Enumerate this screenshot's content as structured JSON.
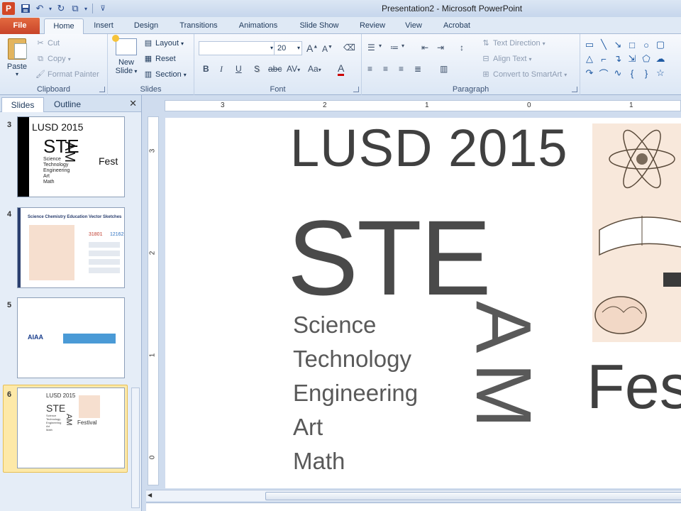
{
  "window": {
    "title": "Presentation2 - Microsoft PowerPoint",
    "app_icon_letter": "P"
  },
  "tabs": [
    {
      "label": "File"
    },
    {
      "label": "Home"
    },
    {
      "label": "Insert"
    },
    {
      "label": "Design"
    },
    {
      "label": "Transitions"
    },
    {
      "label": "Animations"
    },
    {
      "label": "Slide Show"
    },
    {
      "label": "Review"
    },
    {
      "label": "View"
    },
    {
      "label": "Acrobat"
    }
  ],
  "ribbon": {
    "clipboard": {
      "label": "Clipboard",
      "paste": "Paste",
      "cut": "Cut",
      "copy": "Copy",
      "format_painter": "Format Painter"
    },
    "slides": {
      "label": "Slides",
      "new_slide_1": "New",
      "new_slide_2": "Slide",
      "layout": "Layout",
      "reset": "Reset",
      "section": "Section"
    },
    "font": {
      "label": "Font",
      "font_name": "",
      "font_size": "20",
      "bold": "B",
      "italic": "I",
      "underline": "U",
      "shadow": "S",
      "strike": "abc",
      "spacing": "AV",
      "case": "Aa",
      "color": "A",
      "grow": "A",
      "shrink": "A"
    },
    "paragraph": {
      "label": "Paragraph",
      "text_direction": "Text Direction",
      "align_text": "Align Text",
      "convert_smartart": "Convert to SmartArt"
    }
  },
  "panes": {
    "slides_tab": "Slides",
    "outline_tab": "Outline"
  },
  "thumbnails": [
    {
      "number": "3",
      "title": "LUSD 2015",
      "ste": "STE",
      "am": "AM",
      "fest": "Fest",
      "list": [
        "Science",
        "Technology",
        "Engineering",
        "Art",
        "Math"
      ]
    },
    {
      "number": "4",
      "title": "Science Chemistry Education Vector Sketches",
      "stat1": "31801",
      "stat2": "12162"
    },
    {
      "number": "5",
      "logo": "AIAA"
    },
    {
      "number": "6",
      "title": "LUSD 2015",
      "ste": "STE",
      "am": "AM",
      "fest": "Festival",
      "list": [
        "Science",
        "Technology",
        "Engineering",
        "Art",
        "Math"
      ]
    }
  ],
  "ruler": {
    "h_marks": [
      "3",
      "2",
      "1",
      "0",
      "1"
    ],
    "v_marks": [
      "3",
      "2",
      "1",
      "0"
    ]
  },
  "slide": {
    "title": "LUSD 2015",
    "ste": "STE",
    "am": "AM",
    "fest": "Fes",
    "list": [
      "Science",
      "Technology",
      "Engineering",
      "Art",
      "Math"
    ]
  },
  "colors": {
    "file_tab": "#c8442a",
    "accent": "#2a4d8f",
    "selected_thumb": "#f7d86a"
  }
}
